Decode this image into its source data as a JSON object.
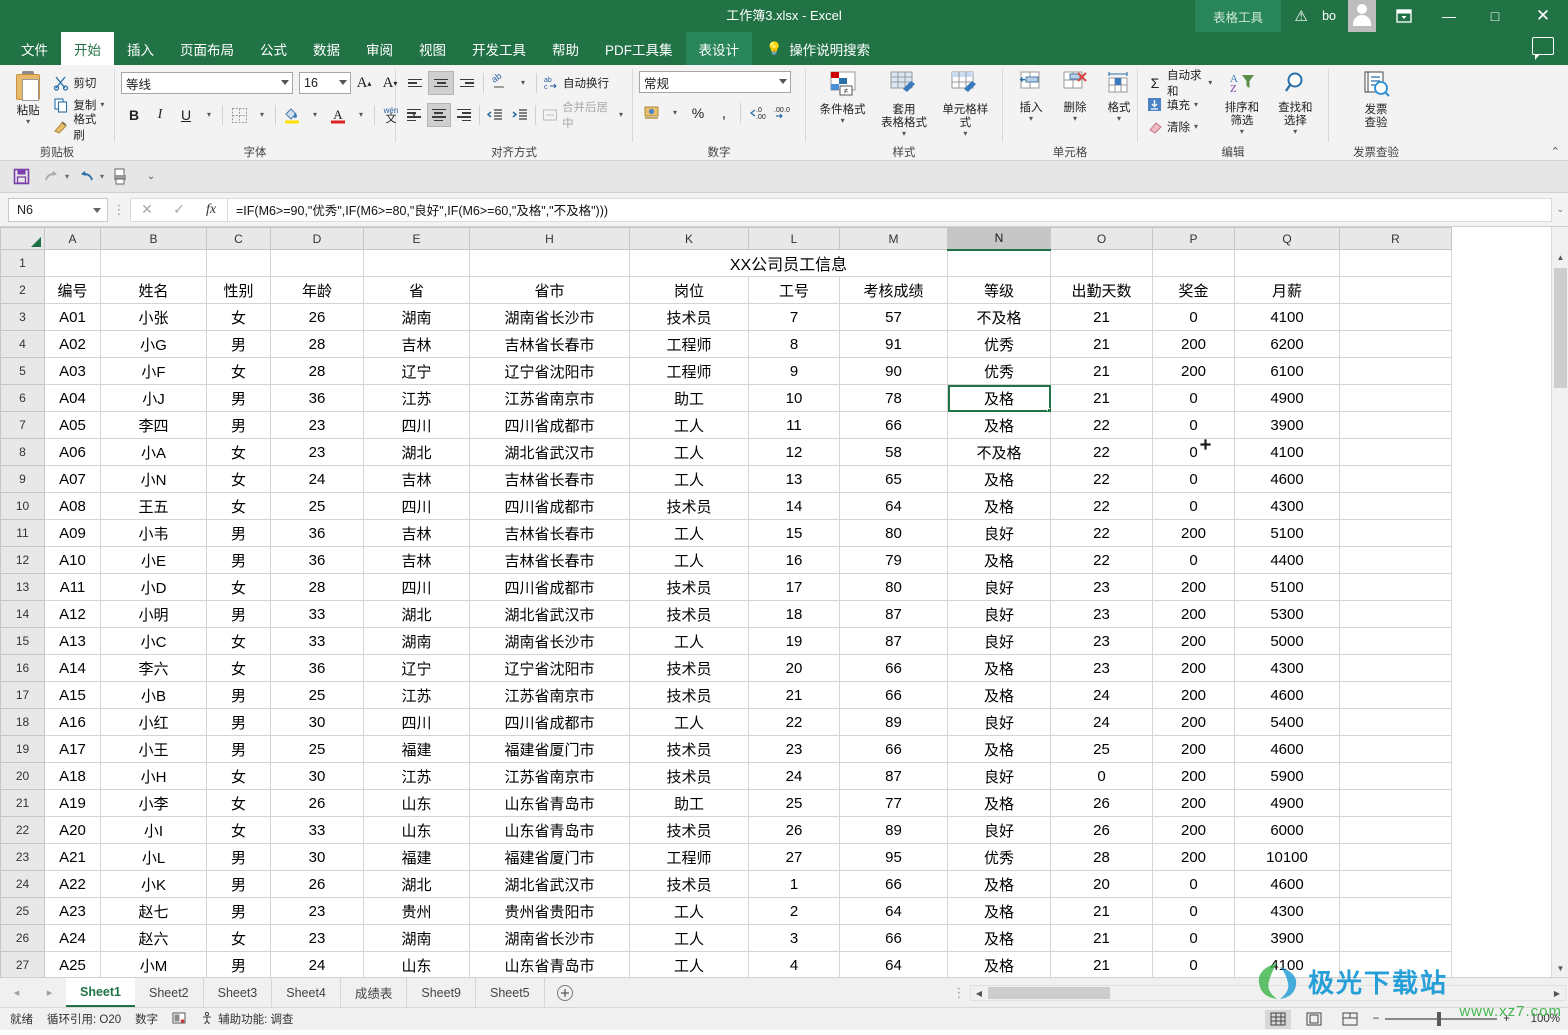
{
  "titlebar": {
    "document_title": "工作簿3.xlsx  -  Excel",
    "context_tab_group": "表格工具",
    "account_name": "bo",
    "warning_icon": "warning-triangle-icon",
    "ribbon_display_icon": "ribbon-display-options-icon",
    "minimize": "—",
    "maximize": "□",
    "close": "✕"
  },
  "tabs": [
    {
      "label": "文件",
      "active": false
    },
    {
      "label": "开始",
      "active": true
    },
    {
      "label": "插入",
      "active": false
    },
    {
      "label": "页面布局",
      "active": false
    },
    {
      "label": "公式",
      "active": false
    },
    {
      "label": "数据",
      "active": false
    },
    {
      "label": "审阅",
      "active": false
    },
    {
      "label": "视图",
      "active": false
    },
    {
      "label": "开发工具",
      "active": false
    },
    {
      "label": "帮助",
      "active": false
    },
    {
      "label": "PDF工具集",
      "active": false
    },
    {
      "label": "表设计",
      "active": false,
      "contextual": true
    }
  ],
  "tell_me": "操作说明搜索",
  "ribbon": {
    "clipboard": {
      "title": "剪贴板",
      "paste": "粘贴",
      "cut": "剪切",
      "copy": "复制",
      "format_painter": "格式刷"
    },
    "font": {
      "title": "字体",
      "font_name": "等线",
      "font_size": "16",
      "grow_font": "A",
      "shrink_font": "A",
      "bold": "B",
      "italic": "I",
      "underline": "U",
      "borders": "borders-icon",
      "fill_color": "fill-color-icon",
      "font_color": "font-color-icon",
      "phonetic": "拼音",
      "phonetic_sub": "文"
    },
    "alignment": {
      "title": "对齐方式",
      "wrap_text": "自动换行",
      "merge_center": "合并后居中",
      "orientation": "orientation-icon",
      "decrease_indent": "decrease-indent-icon",
      "increase_indent": "increase-indent-icon"
    },
    "number": {
      "title": "数字",
      "format": "常规",
      "accounting": "accounting-format-icon",
      "percent": "%",
      "comma": ",",
      "increase_decimal": ".00",
      "decrease_decimal": ".0"
    },
    "styles": {
      "title": "样式",
      "conditional": "条件格式",
      "table_format_l1": "套用",
      "table_format_l2": "表格格式",
      "cell_styles": "单元格样式"
    },
    "cells": {
      "title": "单元格",
      "insert": "插入",
      "delete": "删除",
      "format": "格式"
    },
    "editing": {
      "title": "编辑",
      "autosum": "自动求和",
      "fill": "填充",
      "clear": "清除",
      "sort_filter": "排序和筛选",
      "find_select": "查找和选择"
    },
    "invoice": {
      "title": "发票查验",
      "btn_l1": "发票",
      "btn_l2": "查验"
    },
    "collapse_ribbon": "collapse-ribbon-icon"
  },
  "qat": {
    "save": "save-icon",
    "redo": "redo-icon",
    "undo": "undo-icon",
    "print_preview": "print-preview-icon",
    "customize": "customize-qat-icon"
  },
  "formula_bar": {
    "name_box": "N6",
    "cancel": "✕",
    "enter": "✓",
    "insert_function": "fx",
    "formula": "=IF(M6>=90,\"优秀\",IF(M6>=80,\"良好\",IF(M6>=60,\"及格\",\"不及格\")))"
  },
  "grid": {
    "column_headers": [
      "A",
      "B",
      "C",
      "D",
      "E",
      "H",
      "K",
      "L",
      "M",
      "N",
      "O",
      "P",
      "Q",
      "R"
    ],
    "selected_column": "N",
    "selected_cell": "N6",
    "row_numbers": [
      1,
      2,
      3,
      4,
      5,
      6,
      7,
      8,
      9,
      10,
      11,
      12,
      13,
      14,
      15,
      16,
      17,
      18,
      19,
      20,
      21,
      22,
      23,
      24,
      25,
      26,
      27
    ],
    "title_row": "XX公司员工信息",
    "headers": [
      "编号",
      "姓名",
      "性别",
      "年龄",
      "省",
      "省市",
      "岗位",
      "工号",
      "考核成绩",
      "等级",
      "出勤天数",
      "奖金",
      "月薪"
    ],
    "rows": [
      [
        "A01",
        "小张",
        "女",
        "26",
        "湖南",
        "湖南省长沙市",
        "技术员",
        "7",
        "57",
        "不及格",
        "21",
        "0",
        "4100"
      ],
      [
        "A02",
        "小G",
        "男",
        "28",
        "吉林",
        "吉林省长春市",
        "工程师",
        "8",
        "91",
        "优秀",
        "21",
        "200",
        "6200"
      ],
      [
        "A03",
        "小F",
        "女",
        "28",
        "辽宁",
        "辽宁省沈阳市",
        "工程师",
        "9",
        "90",
        "优秀",
        "21",
        "200",
        "6100"
      ],
      [
        "A04",
        "小J",
        "男",
        "36",
        "江苏",
        "江苏省南京市",
        "助工",
        "10",
        "78",
        "及格",
        "21",
        "0",
        "4900"
      ],
      [
        "A05",
        "李四",
        "男",
        "23",
        "四川",
        "四川省成都市",
        "工人",
        "11",
        "66",
        "及格",
        "22",
        "0",
        "3900"
      ],
      [
        "A06",
        "小A",
        "女",
        "23",
        "湖北",
        "湖北省武汉市",
        "工人",
        "12",
        "58",
        "不及格",
        "22",
        "0",
        "4100"
      ],
      [
        "A07",
        "小N",
        "女",
        "24",
        "吉林",
        "吉林省长春市",
        "工人",
        "13",
        "65",
        "及格",
        "22",
        "0",
        "4600"
      ],
      [
        "A08",
        "王五",
        "女",
        "25",
        "四川",
        "四川省成都市",
        "技术员",
        "14",
        "64",
        "及格",
        "22",
        "0",
        "4300"
      ],
      [
        "A09",
        "小韦",
        "男",
        "36",
        "吉林",
        "吉林省长春市",
        "工人",
        "15",
        "80",
        "良好",
        "22",
        "200",
        "5100"
      ],
      [
        "A10",
        "小E",
        "男",
        "36",
        "吉林",
        "吉林省长春市",
        "工人",
        "16",
        "79",
        "及格",
        "22",
        "0",
        "4400"
      ],
      [
        "A11",
        "小D",
        "女",
        "28",
        "四川",
        "四川省成都市",
        "技术员",
        "17",
        "80",
        "良好",
        "23",
        "200",
        "5100"
      ],
      [
        "A12",
        "小明",
        "男",
        "33",
        "湖北",
        "湖北省武汉市",
        "技术员",
        "18",
        "87",
        "良好",
        "23",
        "200",
        "5300"
      ],
      [
        "A13",
        "小C",
        "女",
        "33",
        "湖南",
        "湖南省长沙市",
        "工人",
        "19",
        "87",
        "良好",
        "23",
        "200",
        "5000"
      ],
      [
        "A14",
        "李六",
        "女",
        "36",
        "辽宁",
        "辽宁省沈阳市",
        "技术员",
        "20",
        "66",
        "及格",
        "23",
        "200",
        "4300"
      ],
      [
        "A15",
        "小B",
        "男",
        "25",
        "江苏",
        "江苏省南京市",
        "技术员",
        "21",
        "66",
        "及格",
        "24",
        "200",
        "4600"
      ],
      [
        "A16",
        "小红",
        "男",
        "30",
        "四川",
        "四川省成都市",
        "工人",
        "22",
        "89",
        "良好",
        "24",
        "200",
        "5400"
      ],
      [
        "A17",
        "小王",
        "男",
        "25",
        "福建",
        "福建省厦门市",
        "技术员",
        "23",
        "66",
        "及格",
        "25",
        "200",
        "4600"
      ],
      [
        "A18",
        "小H",
        "女",
        "30",
        "江苏",
        "江苏省南京市",
        "技术员",
        "24",
        "87",
        "良好",
        "0",
        "200",
        "5900"
      ],
      [
        "A19",
        "小李",
        "女",
        "26",
        "山东",
        "山东省青岛市",
        "助工",
        "25",
        "77",
        "及格",
        "26",
        "200",
        "4900"
      ],
      [
        "A20",
        "小I",
        "女",
        "33",
        "山东",
        "山东省青岛市",
        "技术员",
        "26",
        "89",
        "良好",
        "26",
        "200",
        "6000"
      ],
      [
        "A21",
        "小L",
        "男",
        "30",
        "福建",
        "福建省厦门市",
        "工程师",
        "27",
        "95",
        "优秀",
        "28",
        "200",
        "10100"
      ],
      [
        "A22",
        "小K",
        "男",
        "26",
        "湖北",
        "湖北省武汉市",
        "技术员",
        "1",
        "66",
        "及格",
        "20",
        "0",
        "4600"
      ],
      [
        "A23",
        "赵七",
        "男",
        "23",
        "贵州",
        "贵州省贵阳市",
        "工人",
        "2",
        "64",
        "及格",
        "21",
        "0",
        "4300"
      ],
      [
        "A24",
        "赵六",
        "女",
        "23",
        "湖南",
        "湖南省长沙市",
        "工人",
        "3",
        "66",
        "及格",
        "21",
        "0",
        "3900"
      ],
      [
        "A25",
        "小M",
        "男",
        "24",
        "山东",
        "山东省青岛市",
        "工人",
        "4",
        "64",
        "及格",
        "21",
        "0",
        "4100"
      ]
    ]
  },
  "sheet_tabs": {
    "prev": "◂",
    "next": "▸",
    "items": [
      {
        "label": "Sheet1",
        "active": true
      },
      {
        "label": "Sheet2",
        "active": false
      },
      {
        "label": "Sheet3",
        "active": false
      },
      {
        "label": "Sheet4",
        "active": false
      },
      {
        "label": "成绩表",
        "active": false
      },
      {
        "label": "Sheet9",
        "active": false
      },
      {
        "label": "Sheet5",
        "active": false
      }
    ],
    "add": "+"
  },
  "status_bar": {
    "mode": "就绪",
    "circular_ref": "循环引用: O20",
    "number_mode": "数字",
    "macro_icon": "record-macro-icon",
    "accessibility": "辅助功能: 调查",
    "view_normal": "normal-view-icon",
    "view_page_layout": "page-layout-view-icon",
    "view_page_break": "page-break-view-icon",
    "zoom_out": "−",
    "zoom_in": "+",
    "zoom_level": "100%"
  },
  "watermark": {
    "text": "极光下载站",
    "url": "www.xz7.com"
  }
}
